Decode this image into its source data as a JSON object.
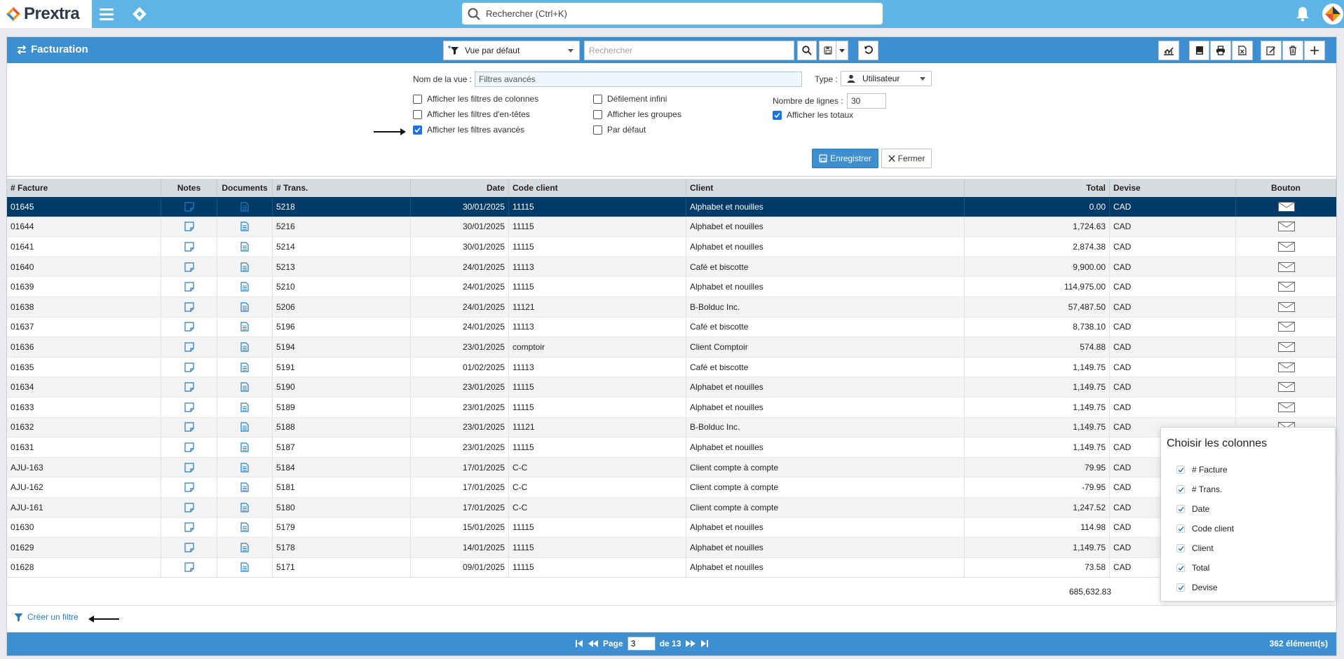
{
  "app": {
    "logo_text": "Prextra"
  },
  "global_search": {
    "placeholder": "Rechercher (Ctrl+K)"
  },
  "panel": {
    "title": "Facturation",
    "view_select": "Vue par défaut",
    "search_placeholder": "Rechercher"
  },
  "config": {
    "view_name_label": "Nom de la vue :",
    "view_name_value": "Filtres avancés",
    "type_label": "Type :",
    "type_value": "Utilisateur",
    "rows_label": "Nombre de lignes :",
    "rows_value": "30",
    "options": [
      {
        "label": "Afficher les filtres de colonnes",
        "checked": false
      },
      {
        "label": "Afficher les filtres d'en-têtes",
        "checked": false
      },
      {
        "label": "Afficher les filtres avancés",
        "checked": true
      },
      {
        "label": "Défilement infini",
        "checked": false
      },
      {
        "label": "Afficher les groupes",
        "checked": false
      },
      {
        "label": "Par défaut",
        "checked": false
      },
      {
        "label": "Afficher les totaux",
        "checked": true
      }
    ],
    "save_label": "Enregistrer",
    "close_label": "Fermer"
  },
  "table": {
    "headers": [
      "# Facture",
      "Notes",
      "Documents",
      "# Trans.",
      "Date",
      "Code client",
      "Client",
      "Total",
      "Devise",
      "Bouton"
    ],
    "rows": [
      [
        "01645",
        "5218",
        "30/01/2025",
        "11115",
        "Alphabet et nouilles",
        "0.00",
        "CAD"
      ],
      [
        "01644",
        "5216",
        "30/01/2025",
        "11115",
        "Alphabet et nouilles",
        "1,724.63",
        "CAD"
      ],
      [
        "01641",
        "5214",
        "30/01/2025",
        "11115",
        "Alphabet et nouilles",
        "2,874.38",
        "CAD"
      ],
      [
        "01640",
        "5213",
        "24/01/2025",
        "11113",
        "Café et biscotte",
        "9,900.00",
        "CAD"
      ],
      [
        "01639",
        "5210",
        "24/01/2025",
        "11115",
        "Alphabet et nouilles",
        "114,975.00",
        "CAD"
      ],
      [
        "01638",
        "5206",
        "24/01/2025",
        "11121",
        "B-Bolduc Inc.",
        "57,487.50",
        "CAD"
      ],
      [
        "01637",
        "5196",
        "24/01/2025",
        "11113",
        "Café et biscotte",
        "8,738.10",
        "CAD"
      ],
      [
        "01636",
        "5194",
        "23/01/2025",
        "comptoir",
        "Client Comptoir",
        "574.88",
        "CAD"
      ],
      [
        "01635",
        "5191",
        "01/02/2025",
        "11113",
        "Café et biscotte",
        "1,149.75",
        "CAD"
      ],
      [
        "01634",
        "5190",
        "23/01/2025",
        "11115",
        "Alphabet et nouilles",
        "1,149.75",
        "CAD"
      ],
      [
        "01633",
        "5189",
        "23/01/2025",
        "11115",
        "Alphabet et nouilles",
        "1,149.75",
        "CAD"
      ],
      [
        "01632",
        "5188",
        "23/01/2025",
        "11121",
        "B-Bolduc Inc.",
        "1,149.75",
        "CAD"
      ],
      [
        "01631",
        "5187",
        "23/01/2025",
        "11115",
        "Alphabet et nouilles",
        "1,149.75",
        "CAD"
      ],
      [
        "AJU-163",
        "5184",
        "17/01/2025",
        "C-C",
        "Client compte à compte",
        "79.95",
        "CAD"
      ],
      [
        "AJU-162",
        "5181",
        "17/01/2025",
        "C-C",
        "Client compte à compte",
        "-79.95",
        "CAD"
      ],
      [
        "AJU-161",
        "5180",
        "17/01/2025",
        "C-C",
        "Client compte à compte",
        "1,247.52",
        "CAD"
      ],
      [
        "01630",
        "5179",
        "15/01/2025",
        "11115",
        "Alphabet et nouilles",
        "114.98",
        "CAD"
      ],
      [
        "01629",
        "5178",
        "14/01/2025",
        "11115",
        "Alphabet et nouilles",
        "1,149.75",
        "CAD"
      ],
      [
        "01628",
        "5171",
        "09/01/2025",
        "11115",
        "Alphabet et nouilles",
        "73.58",
        "CAD"
      ]
    ],
    "total": "685,632.83"
  },
  "create_filter_label": "Créer un filtre",
  "footer": {
    "page_label": "Page",
    "page_value": "3",
    "of_label": "de 13",
    "count": "362 élément(s)"
  },
  "chooser": {
    "title": "Choisir les colonnes",
    "items": [
      "# Facture",
      "# Trans.",
      "Date",
      "Code client",
      "Client",
      "Total",
      "Devise"
    ]
  },
  "colors": {
    "topbar": "#5fb4e6",
    "header": "#3d8fcf",
    "selected_row": "#003a67",
    "link": "#2a7bc0"
  }
}
